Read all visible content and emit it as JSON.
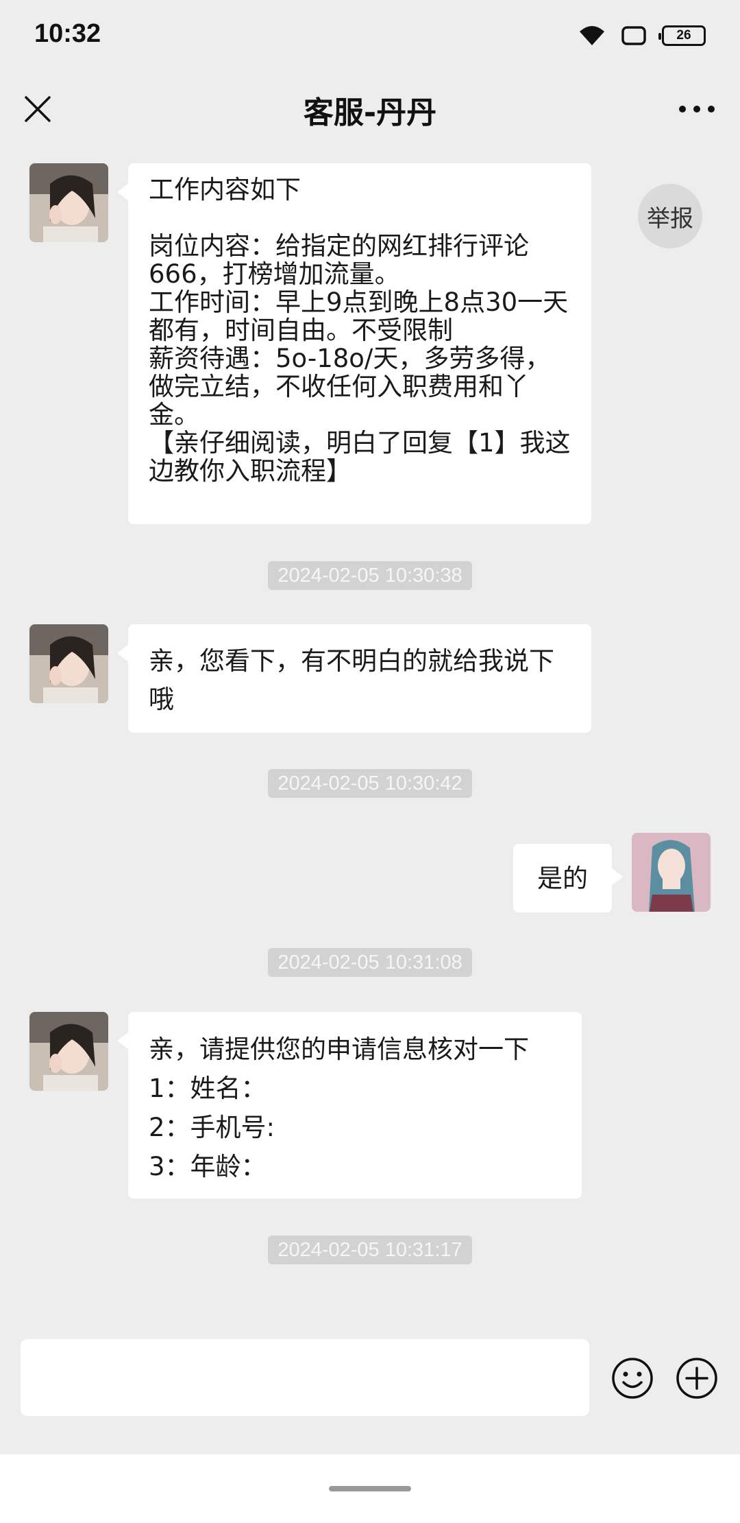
{
  "status_bar": {
    "time": "10:32",
    "battery": "26",
    "icons": [
      "wifi-icon",
      "screen-icon",
      "battery-icon"
    ]
  },
  "header": {
    "title": "客服-丹丹",
    "close_icon": "close-icon",
    "more_icon": "more-icon"
  },
  "report_label": "举报",
  "messages": [
    {
      "side": "left",
      "text": "工作内容如下\n\n岗位内容：给指定的网红排行评论666，打榜增加流量。\n工作时间：早上9点到晚上8点30一天都有，时间自由。不受限制\n薪资待遇：5o-18o/天，多劳多得，做完立结，不收任何入职费用和丫金。\n【亲仔细阅读，明白了回复【1】我这边教你入职流程】"
    },
    {
      "timestamp": "2024-02-05 10:30:38"
    },
    {
      "side": "left",
      "text": "亲，您看下，有不明白的就给我说下哦"
    },
    {
      "timestamp": "2024-02-05 10:30:42"
    },
    {
      "side": "right",
      "text": "是的"
    },
    {
      "timestamp": "2024-02-05 10:31:08"
    },
    {
      "side": "left",
      "text": "亲，请提供您的申请信息核对一下\n1：姓名：\n2：手机号:\n3：年龄："
    },
    {
      "timestamp": "2024-02-05 10:31:17"
    }
  ],
  "input": {
    "placeholder": "",
    "emoji_icon": "emoji-icon",
    "plus_icon": "plus-icon"
  },
  "colors": {
    "background": "#ededed",
    "bubble": "#ffffff",
    "timestamp_bg": "#d2d2d2"
  }
}
